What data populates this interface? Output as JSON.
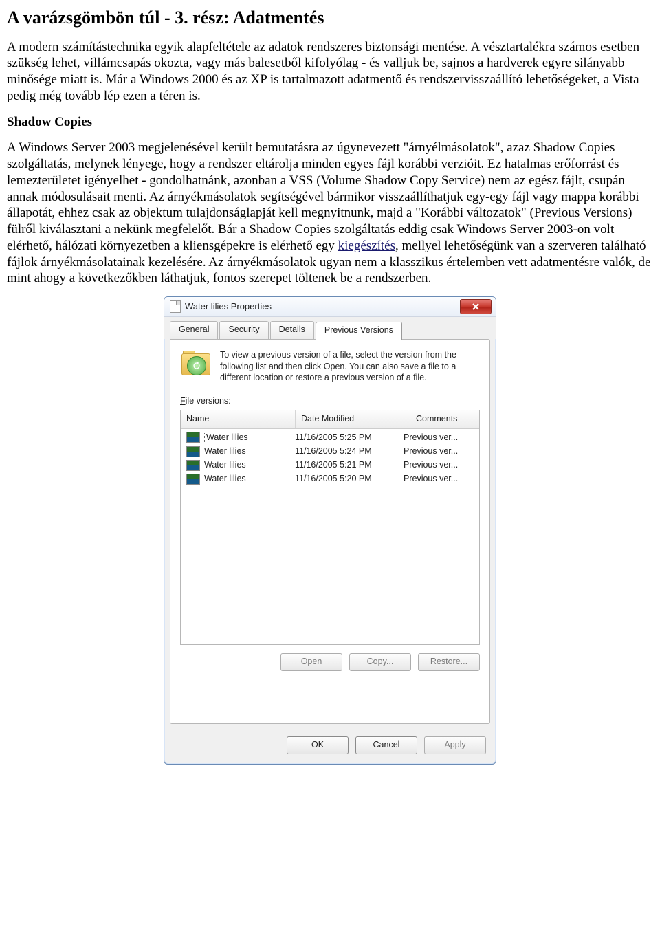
{
  "article": {
    "title": "A varázsgömbön túl - 3. rész: Adatmentés",
    "intro": "A modern számítástechnika egyik alapfeltétele az adatok rendszeres biztonsági mentése. A vésztartalékra számos esetben szükség lehet, villámcsapás okozta, vagy más balesetből kifolyólag - és valljuk be, sajnos a hardverek egyre silányabb minősége miatt is. Már a Windows 2000 és az XP is tartalmazott adatmentő és rendszervisszaállító lehetőségeket, a Vista pedig még tovább lép ezen a téren is.",
    "section1_heading": "Shadow Copies",
    "section1_body_part1": "A Windows Server 2003 megjelenésével került bemutatásra az úgynevezett \"árnyélmásolatok\", azaz Shadow Copies szolgáltatás, melynek lényege, hogy a rendszer eltárolja minden egyes fájl korábbi verzióit. Ez hatalmas erőforrást és lemezterületet igényelhet - gondolhatnánk, azonban a VSS (Volume Shadow Copy Service) nem az egész fájlt, csupán annak módosulásait menti. Az árnyékmásolatok segítségével bármikor visszaállíthatjuk egy-egy fájl vagy mappa korábbi állapotát, ehhez csak az objektum tulajdonságlapját kell megnyitnunk, majd a \"Korábbi változatok\" (Previous Versions) fülről kiválasztani a nekünk megfelelőt. Bár a Shadow Copies szolgáltatás eddig csak Windows Server 2003-on volt elérhető, hálózati környezetben a kliensgépekre is elérhető egy ",
    "section1_link_text": "kiegészítés",
    "section1_body_part2": ", mellyel lehetőségünk van a szerveren található fájlok árnyékmásolatainak kezelésére. Az árnyékmásolatok ugyan nem a klasszikus értelemben vett adatmentésre valók, de mint ahogy a következőkben láthatjuk, fontos szerepet töltenek be a rendszerben."
  },
  "dialog": {
    "title": "Water lilies Properties",
    "tabs": [
      "General",
      "Security",
      "Details",
      "Previous Versions"
    ],
    "active_tab_index": 3,
    "info_text": "To view a previous version of a file, select the version from the following list and then click Open.  You can also save a file to a different location or restore a previous version of a file.",
    "file_versions_label": "File versions:",
    "columns": [
      "Name",
      "Date Modified",
      "Comments"
    ],
    "rows": [
      {
        "name": "Water lilies",
        "date": "11/16/2005 5:25 PM",
        "comment": "Previous ver...",
        "selected": true
      },
      {
        "name": "Water lilies",
        "date": "11/16/2005 5:24 PM",
        "comment": "Previous ver...",
        "selected": false
      },
      {
        "name": "Water lilies",
        "date": "11/16/2005 5:21 PM",
        "comment": "Previous ver...",
        "selected": false
      },
      {
        "name": "Water lilies",
        "date": "11/16/2005 5:20 PM",
        "comment": "Previous ver...",
        "selected": false
      }
    ],
    "buttons_row": {
      "open": "Open",
      "copy": "Copy...",
      "restore": "Restore..."
    },
    "footer": {
      "ok": "OK",
      "cancel": "Cancel",
      "apply": "Apply"
    }
  }
}
